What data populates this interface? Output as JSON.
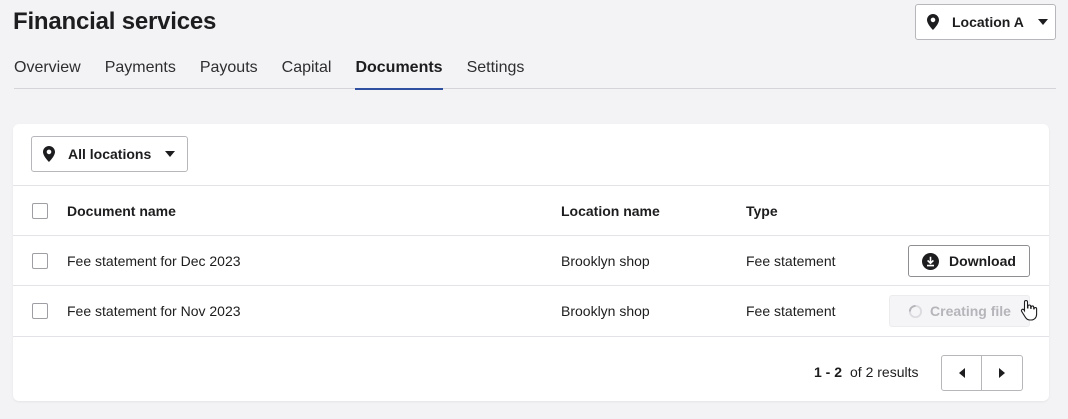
{
  "header": {
    "title": "Financial services"
  },
  "location_select": {
    "value": "Location A"
  },
  "tabs": [
    {
      "label": "Overview"
    },
    {
      "label": "Payments"
    },
    {
      "label": "Payouts"
    },
    {
      "label": "Capital"
    },
    {
      "label": "Documents",
      "active": true
    },
    {
      "label": "Settings"
    }
  ],
  "filter": {
    "value": "All locations"
  },
  "table": {
    "columns": [
      "Document name",
      "Location name",
      "Type"
    ],
    "rows": [
      {
        "document": "Fee statement for Dec 2023",
        "location": "Brooklyn shop",
        "type": "Fee statement",
        "action": "Download"
      },
      {
        "document": "Fee statement for Nov 2023",
        "location": "Brooklyn shop",
        "type": "Fee statement",
        "action": "Creating file"
      }
    ]
  },
  "pagination": {
    "range": "1 - 2",
    "total_text": "of 2 results"
  },
  "colors": {
    "accent": "#2f4fa1",
    "background": "#f3f2f4"
  }
}
